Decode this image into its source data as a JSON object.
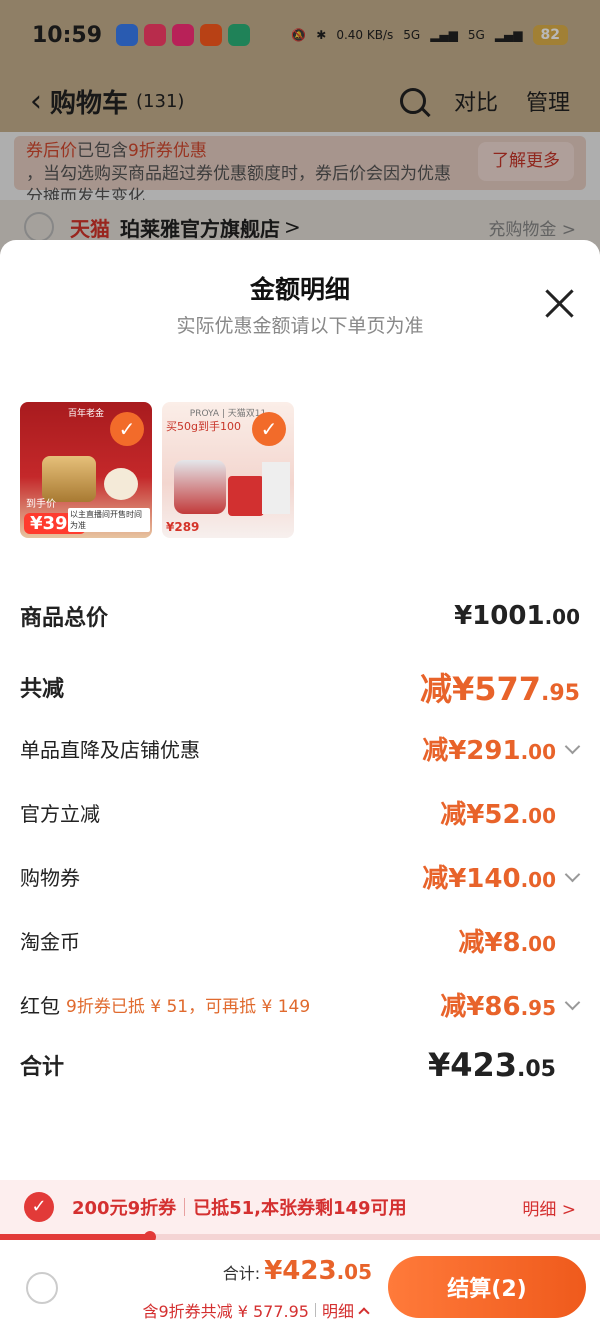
{
  "status_bar": {
    "time": "10:59",
    "speed": "0.40 KB/s",
    "net1": "5G",
    "net2": "5G",
    "battery": "82"
  },
  "nav": {
    "title": "购物车",
    "count": "(131)",
    "compare": "对比",
    "manage": "管理"
  },
  "notice": {
    "highlight1": "券后价",
    "text1": "已包含",
    "highlight2": "9折券优惠",
    "text2": "，当勾选购买商品超过券优惠额度时，券后价会因为优惠分摊而发生变化",
    "button": "了解更多"
  },
  "store": {
    "tmall": "天猫",
    "name": "珀莱雅官方旗舰店",
    "arrow": ">",
    "extra": "充购物金 >"
  },
  "sheet": {
    "title": "金额明细",
    "subtitle": "实际优惠金额请以下单页为准"
  },
  "thumbs": [
    {
      "brand": "百年老金",
      "price": "¥399",
      "price_tag": "到手价",
      "foot": "以主直播间开售时间为准"
    },
    {
      "brand": "PROYA | 天猫双11",
      "promo": "买50g到手100",
      "price": "¥289"
    }
  ],
  "rows": {
    "total_label": "商品总价",
    "total_int": "¥1001",
    "total_dec": ".00",
    "reduce_label": "共减",
    "reduce_int": "减¥577",
    "reduce_dec": ".95",
    "item1_label": "单品直降及店铺优惠",
    "item1_int": "减¥291",
    "item1_dec": ".00",
    "item2_label": "官方立减",
    "item2_int": "减¥52",
    "item2_dec": ".00",
    "item3_label": "购物券",
    "item3_int": "减¥140",
    "item3_dec": ".00",
    "item4_label": "淘金币",
    "item4_int": "减¥8",
    "item4_dec": ".00",
    "item5_label": "红包",
    "item5_note": "9折券已抵 ¥ 51，可再抵 ¥ 149",
    "item5_int": "减¥86",
    "item5_dec": ".95",
    "sum_label": "合计",
    "sum_int": "¥423",
    "sum_dec": ".05"
  },
  "coupon": {
    "name": "200元9折券",
    "text": "已抵51,本张券剩149可用",
    "detail": "明细 >",
    "progress": 0.25
  },
  "bottom": {
    "total_label": "合计:",
    "total_int": "¥423",
    "total_dec": ".05",
    "saving": "含9折券共减 ¥ 577.95",
    "detail": "明细",
    "checkout": "结算(2)"
  },
  "colors": {
    "accent": "#e8632a",
    "coupon_red": "#e23a38",
    "header_tan": "#c6b08e"
  }
}
